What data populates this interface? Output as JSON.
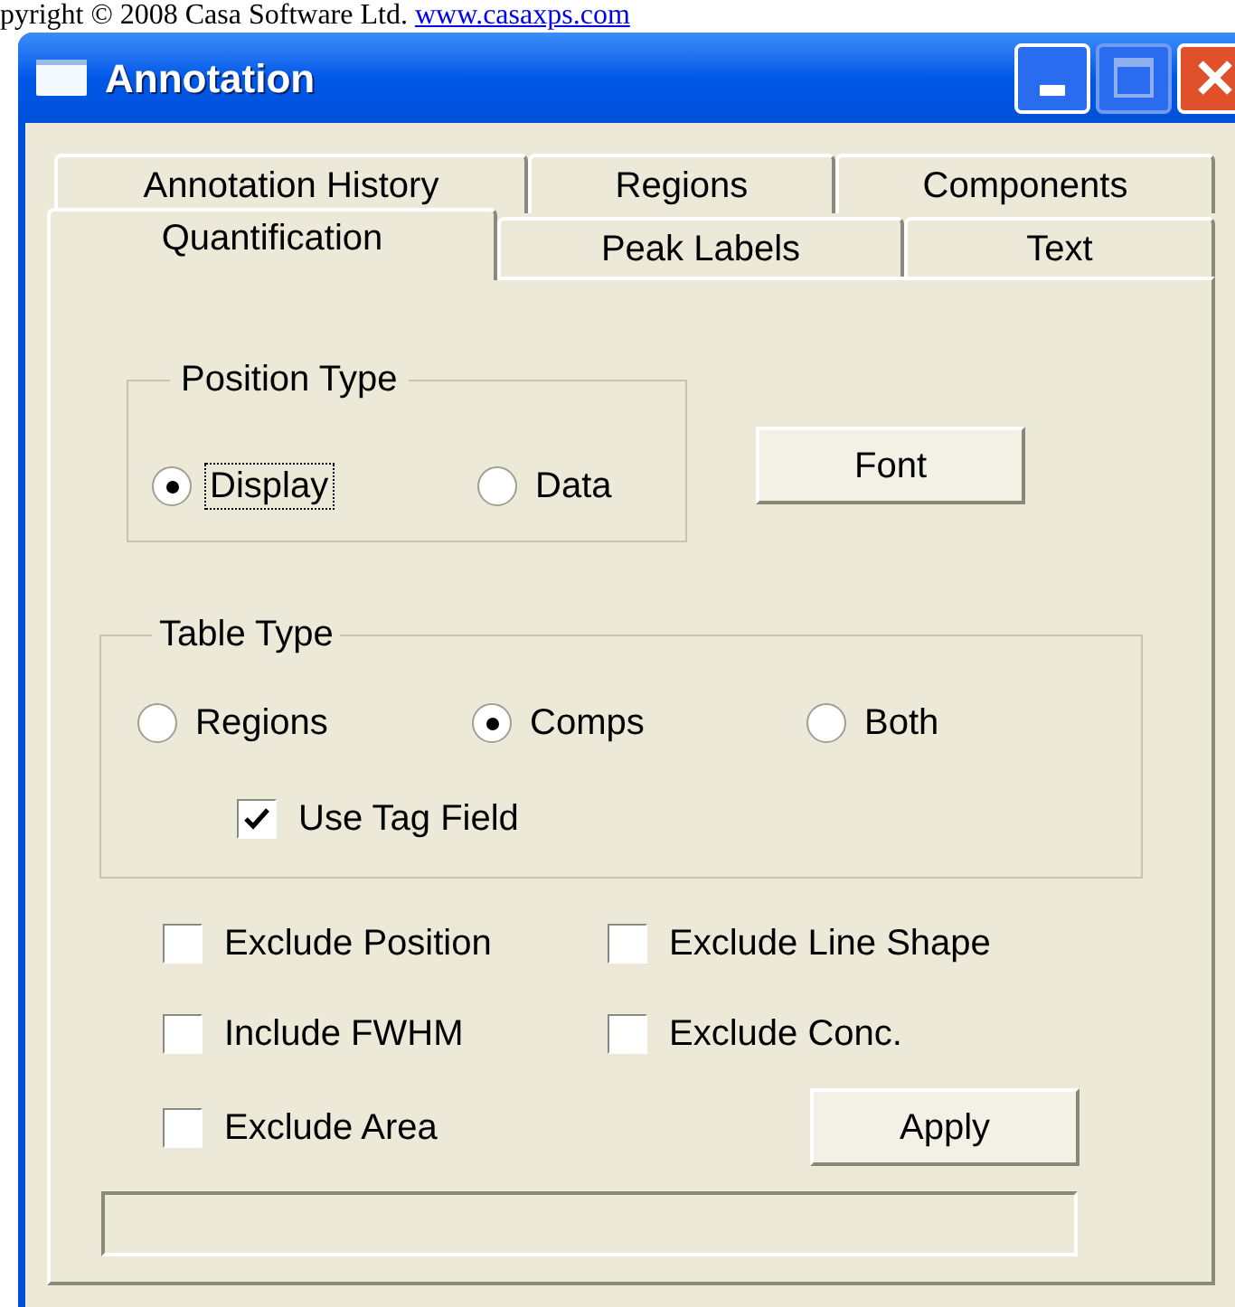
{
  "header": {
    "text": "pyright © 2008 Casa Software Ltd.",
    "link": "www.casaxps.com"
  },
  "window": {
    "title": "Annotation"
  },
  "tab_rows": [
    [
      {
        "label": "Annotation History",
        "selected": false
      },
      {
        "label": "Regions",
        "selected": false
      },
      {
        "label": "Components",
        "selected": false
      }
    ],
    [
      {
        "label": "Quantification",
        "selected": true
      },
      {
        "label": "Peak Labels",
        "selected": false
      },
      {
        "label": "Text",
        "selected": false
      }
    ]
  ],
  "position_type": {
    "title": "Position Type",
    "options": [
      {
        "label": "Display",
        "selected": true,
        "focused": true
      },
      {
        "label": "Data",
        "selected": false,
        "focused": false
      }
    ]
  },
  "font_button": "Font",
  "table_type": {
    "title": "Table Type",
    "options": [
      {
        "label": "Regions",
        "selected": false
      },
      {
        "label": "Comps",
        "selected": true
      },
      {
        "label": "Both",
        "selected": false
      }
    ],
    "use_tag_field": {
      "label": "Use Tag Field",
      "checked": true
    }
  },
  "options": [
    {
      "label": "Exclude Position",
      "checked": false
    },
    {
      "label": "Exclude Line Shape",
      "checked": false
    },
    {
      "label": "Include FWHM",
      "checked": false
    },
    {
      "label": "Exclude Conc.",
      "checked": false
    },
    {
      "label": "Exclude Area",
      "checked": false
    }
  ],
  "apply_button": "Apply"
}
